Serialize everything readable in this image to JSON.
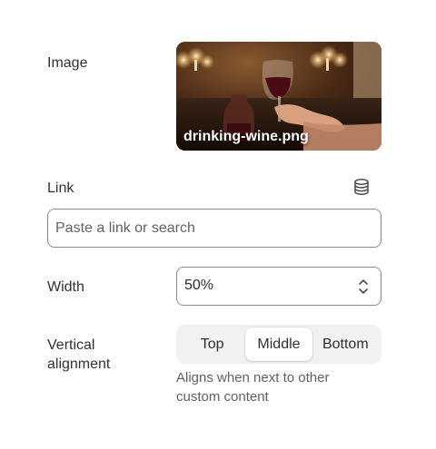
{
  "image": {
    "label": "Image",
    "filename": "drinking-wine.png"
  },
  "link": {
    "label": "Link",
    "placeholder": "Paste a link or search",
    "value": "",
    "source_icon": "database-icon"
  },
  "width": {
    "label": "Width",
    "value": "50%",
    "icon": "chevron-up-down-icon"
  },
  "vertical_alignment": {
    "label_line1": "Vertical",
    "label_line2": "alignment",
    "options": [
      "Top",
      "Middle",
      "Bottom"
    ],
    "selected": "Middle",
    "help_line1": "Aligns when next to other",
    "help_line2": "custom content"
  },
  "colors": {
    "text": "#303030",
    "subdued_text": "#616161",
    "border": "#8a8a8a",
    "segment_bg": "#f1f1f1"
  }
}
